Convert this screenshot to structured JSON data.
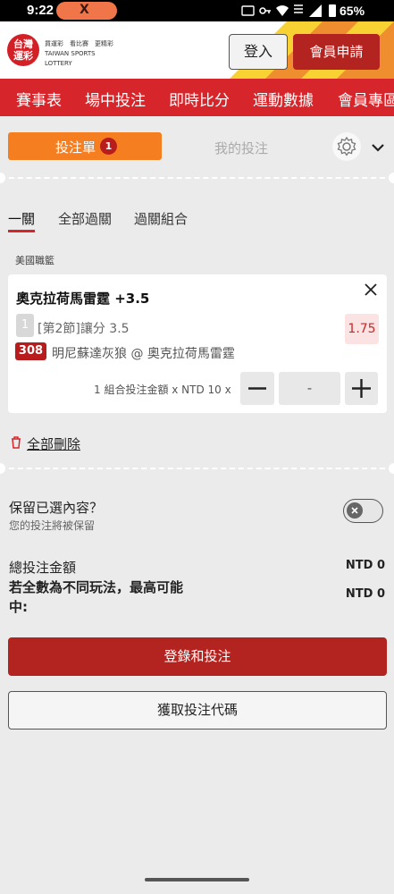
{
  "status_bar": {
    "time": "9:22",
    "notification_app": "X",
    "battery": "65%"
  },
  "header": {
    "logo": {
      "mark": "台灣\n運彩",
      "tagline": "買運彩　看比賽　更精彩",
      "english": "TAIWAN SPORTS LOTTERY"
    },
    "login_label": "登入",
    "join_label": "會員申請"
  },
  "nav": {
    "items": [
      "賽事表",
      "場中投注",
      "即時比分",
      "運動數據",
      "會員專區"
    ]
  },
  "betslip": {
    "tab_label": "投注單",
    "count": "1",
    "my_bets_label": "我的投注"
  },
  "bet_types": {
    "tabs": [
      "一關",
      "全部過關",
      "過關組合"
    ],
    "active": "一關"
  },
  "league": "美國職籃",
  "bet": {
    "title": "奧克拉荷馬雷霆 +3.5",
    "quarter_icon": "1",
    "market": "[第2節]讓分 3.5",
    "odds": "1.75",
    "match_no": "308",
    "match": "明尼蘇達灰狼 @ 奧克拉荷馬雷霆",
    "stake_info": "1 組合投注金額 x NTD 10 x",
    "stake_value": "-"
  },
  "delete_all_label": "全部刪除",
  "keep": {
    "title": "保留已選內容？",
    "subtitle": "您的投注將被保留",
    "enabled": false
  },
  "summary": {
    "total_label": "總投注金額",
    "total_value": "NTD 0",
    "win_label": "若全數為不同玩法，最高可能中:",
    "win_value": "NTD 0"
  },
  "actions": {
    "login_bet_label": "登錄和投注",
    "code_label": "獲取投注代碼"
  },
  "colors": {
    "brand_red": "#d7262b",
    "dark_red": "#b3231f",
    "orange": "#f57f20",
    "bg": "#ebebeb"
  }
}
